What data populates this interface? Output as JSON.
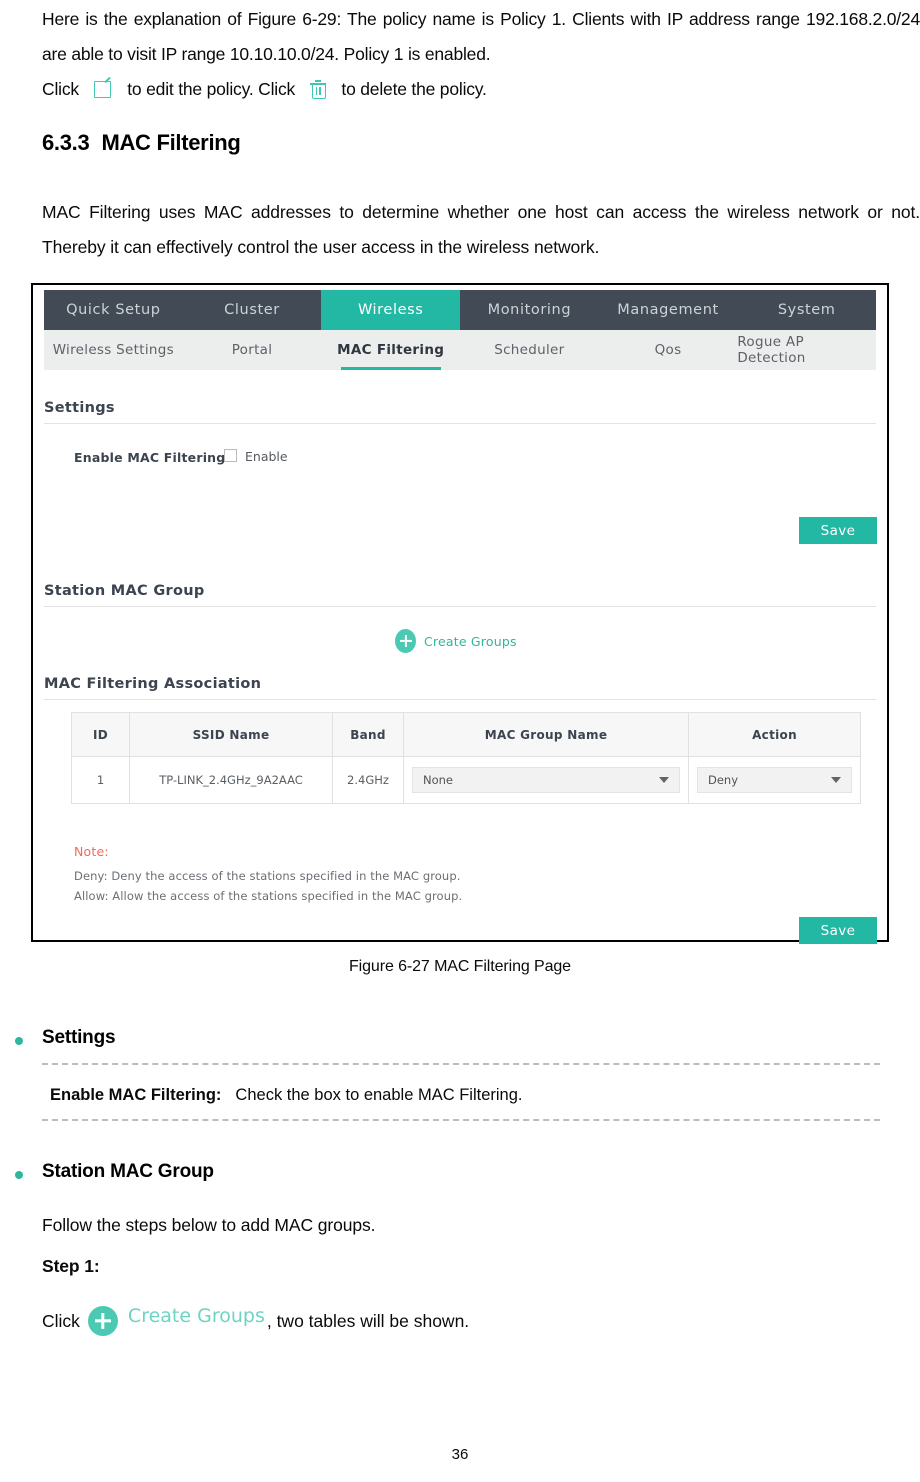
{
  "document": {
    "intro_paragraph": "Here is the explanation of Figure 6-29: The policy name is Policy 1. Clients with IP address range 192.168.2.0/24 are able to visit IP range 10.10.10.0/24. Policy 1 is enabled.",
    "click_line_part1": "Click",
    "click_line_part2": "to edit the policy. Click",
    "click_line_part3": "to delete the policy.",
    "section_number": "6.3.3",
    "section_title": "MAC Filtering",
    "body_paragraph": "MAC Filtering uses MAC addresses to determine whether one host can access the wireless network or not. Thereby it can effectively control the user access in the wireless network.",
    "figure_caption": "Figure 6-27 MAC Filtering Page",
    "page_number": "36"
  },
  "screenshot": {
    "topnav": [
      {
        "label": "Quick Setup",
        "active": false
      },
      {
        "label": "Cluster",
        "active": false
      },
      {
        "label": "Wireless",
        "active": true
      },
      {
        "label": "Monitoring",
        "active": false
      },
      {
        "label": "Management",
        "active": false
      },
      {
        "label": "System",
        "active": false
      }
    ],
    "subnav": [
      {
        "label": "Wireless Settings",
        "active": false
      },
      {
        "label": "Portal",
        "active": false
      },
      {
        "label": "MAC Filtering",
        "active": true
      },
      {
        "label": "Scheduler",
        "active": false
      },
      {
        "label": "Qos",
        "active": false
      },
      {
        "label": "Rogue AP Detection",
        "active": false
      }
    ],
    "settings": {
      "title": "Settings",
      "enable_label": "Enable MAC Filtering:",
      "enable_checkbox_label": "Enable",
      "enable_checked": false,
      "save_label": "Save"
    },
    "station_mac_group": {
      "title": "Station MAC Group",
      "create_groups_label": "Create Groups"
    },
    "association": {
      "title": "MAC Filtering Association",
      "columns": [
        "ID",
        "SSID Name",
        "Band",
        "MAC Group Name",
        "Action"
      ],
      "rows": [
        {
          "id": "1",
          "ssid_name": "TP-LINK_2.4GHz_9A2AAC",
          "band": "2.4GHz",
          "mac_group_name": "None",
          "action": "Deny"
        }
      ],
      "note_title": "Note:",
      "note_lines": [
        "Deny: Deny the access of the stations specified in the MAC group.",
        "Allow: Allow the access of the stations specified in the MAC group."
      ],
      "save_label": "Save"
    },
    "colors": {
      "accent_teal": "#22b8a4",
      "nav_dark": "#414a55",
      "subnav_bg": "#eceded",
      "note_red": "#f16a5a"
    }
  },
  "explanations": {
    "settings_heading": "Settings",
    "enable_mac_filtering_key": "Enable MAC Filtering:",
    "enable_mac_filtering_value": "Check the box to enable MAC Filtering.",
    "station_mac_group_heading": "Station MAC Group",
    "follow_steps": "Follow the steps below to add MAC groups.",
    "step1_label": "Step 1:",
    "step1_click": "Click",
    "step1_button": "Create Groups",
    "step1_rest": ", two tables will be shown."
  }
}
